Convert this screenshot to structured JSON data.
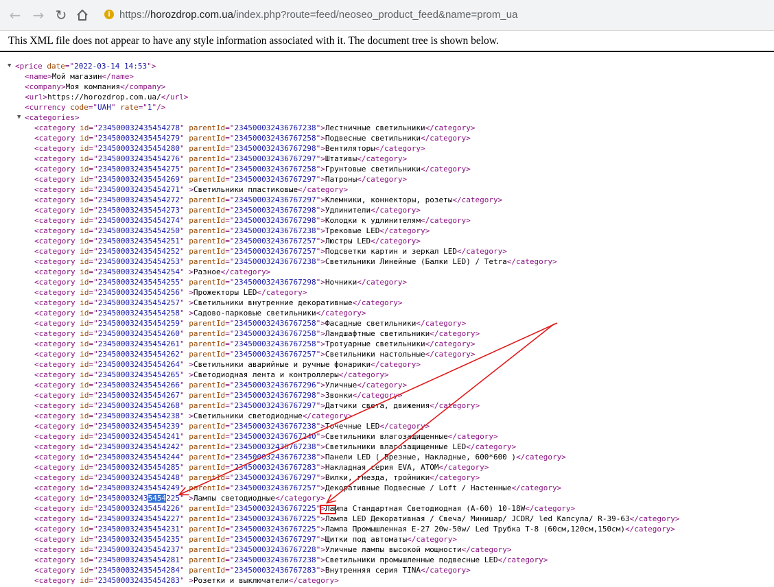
{
  "browser": {
    "url_scheme": "https://",
    "url_host": "horozdrop.com.ua",
    "url_path": "/index.php?route=feed/neoseo_product_feed&name=prom_ua"
  },
  "notice": "This XML file does not appear to have any style information associated with it. The document tree is shown below.",
  "xml": {
    "price_date": "2022-03-14 14:53",
    "name": "Мой магазин",
    "company": "Моя компания",
    "url": "https://horozdrop.com.ua/",
    "currency_code": "UAH",
    "currency_rate": "1",
    "categories": [
      {
        "id": "234500032435454278",
        "parentId": "234500032436767238",
        "name": "Лестничные светильники"
      },
      {
        "id": "234500032435454279",
        "parentId": "234500032436767258",
        "name": "Подвесные светильники"
      },
      {
        "id": "234500032435454280",
        "parentId": "234500032436767298",
        "name": "Вентиляторы"
      },
      {
        "id": "234500032435454276",
        "parentId": "234500032436767297",
        "name": "Штативы"
      },
      {
        "id": "234500032435454275",
        "parentId": "234500032436767258",
        "name": "Грунтовые светильники"
      },
      {
        "id": "234500032435454269",
        "parentId": "234500032436767297",
        "name": "Патроны"
      },
      {
        "id": "234500032435454271",
        "parentId": null,
        "name": "Светильники пластиковые"
      },
      {
        "id": "234500032435454272",
        "parentId": "234500032436767297",
        "name": "Клемники, коннекторы, розеты"
      },
      {
        "id": "234500032435454273",
        "parentId": "234500032436767298",
        "name": "Удлинители"
      },
      {
        "id": "234500032435454274",
        "parentId": "234500032436767298",
        "name": "Колодки к удлинителям"
      },
      {
        "id": "234500032435454250",
        "parentId": "234500032436767238",
        "name": "Трековые LED"
      },
      {
        "id": "234500032435454251",
        "parentId": "234500032436767257",
        "name": "Люстры LED"
      },
      {
        "id": "234500032435454252",
        "parentId": "234500032436767257",
        "name": "Подсветки картин и зеркал LED"
      },
      {
        "id": "234500032435454253",
        "parentId": "234500032436767238",
        "name": "Светильники Линейные (Балки LED) / Tetra"
      },
      {
        "id": "234500032435454254",
        "parentId": null,
        "name": "Разное"
      },
      {
        "id": "234500032435454255",
        "parentId": "234500032436767298",
        "name": "Ночники"
      },
      {
        "id": "234500032435454256",
        "parentId": null,
        "name": "Прожекторы LED"
      },
      {
        "id": "234500032435454257",
        "parentId": null,
        "name": "Светильники внутренние декоративные"
      },
      {
        "id": "234500032435454258",
        "parentId": null,
        "name": "Садово-парковые светильники"
      },
      {
        "id": "234500032435454259",
        "parentId": "234500032436767258",
        "name": "Фасадные светильники"
      },
      {
        "id": "234500032435454260",
        "parentId": "234500032436767258",
        "name": "Ландшафтные светильники"
      },
      {
        "id": "234500032435454261",
        "parentId": "234500032436767258",
        "name": "Тротуарные светильники"
      },
      {
        "id": "234500032435454262",
        "parentId": "234500032436767257",
        "name": "Светильники настольные"
      },
      {
        "id": "234500032435454264",
        "parentId": null,
        "name": "Светильники аварийные и ручные фонарики"
      },
      {
        "id": "234500032435454265",
        "parentId": null,
        "name": "Светодиодная лента и контроллеры"
      },
      {
        "id": "234500032435454266",
        "parentId": "234500032436767296",
        "name": "Уличные"
      },
      {
        "id": "234500032435454267",
        "parentId": "234500032436767298",
        "name": "Звонки"
      },
      {
        "id": "234500032435454268",
        "parentId": "234500032436767297",
        "name": "Датчики света, движения"
      },
      {
        "id": "234500032435454238",
        "parentId": null,
        "name": "Светильники светодиодные"
      },
      {
        "id": "234500032435454239",
        "parentId": "234500032436767238",
        "name": "Точечные LED"
      },
      {
        "id": "234500032435454241",
        "parentId": "234500032436767240",
        "name": "Светильники влагозащищенные"
      },
      {
        "id": "234500032435454242",
        "parentId": "234500032436767238",
        "name": "Светильники влагозащищенные LED"
      },
      {
        "id": "234500032435454244",
        "parentId": "234500032436767238",
        "name": "Панели LED ( Врезные, Накладные, 600*600 )"
      },
      {
        "id": "234500032435454285",
        "parentId": "234500032436767283",
        "name": "Накладная серия EVA, ATOM"
      },
      {
        "id": "234500032435454248",
        "parentId": "234500032436767297",
        "name": "Вилки, гнезда, тройники"
      },
      {
        "id": "234500032435454249",
        "parentId": "234500032436767257",
        "name": "Декоративные Подвесные / Loft / Настенные"
      },
      {
        "id": "234500032435454225",
        "parentId": null,
        "name": "Лампы светодиодные"
      },
      {
        "id": "234500032435454226",
        "parentId": "234500032436767225",
        "name": "Лампа Стандартная Светодиодная (А-60) 10-18W"
      },
      {
        "id": "234500032435454227",
        "parentId": "234500032436767225",
        "name": "Лампа LED Декоративная / Свеча/ Минишар/ JCDR/ led Капсула/ R-39-63"
      },
      {
        "id": "234500032435454231",
        "parentId": "234500032436767225",
        "name": "Лампа Промышленная Е-27 20w-50w/ Led Трубка Т-8 (60см,120см,150см)"
      },
      {
        "id": "234500032435454235",
        "parentId": "234500032436767297",
        "name": "Щитки под автоматы"
      },
      {
        "id": "234500032435454237",
        "parentId": "234500032436767228",
        "name": "Уличные лампы высокой мощности"
      },
      {
        "id": "234500032435454281",
        "parentId": "234500032436767238",
        "name": "Светильники промышленные подвесные LED"
      },
      {
        "id": "234500032435454284",
        "parentId": "234500032436767283",
        "name": "Внутренняя серия TINA"
      },
      {
        "id": "234500032435454283",
        "parentId": null,
        "name": "Розетки и выключатели"
      }
    ]
  }
}
